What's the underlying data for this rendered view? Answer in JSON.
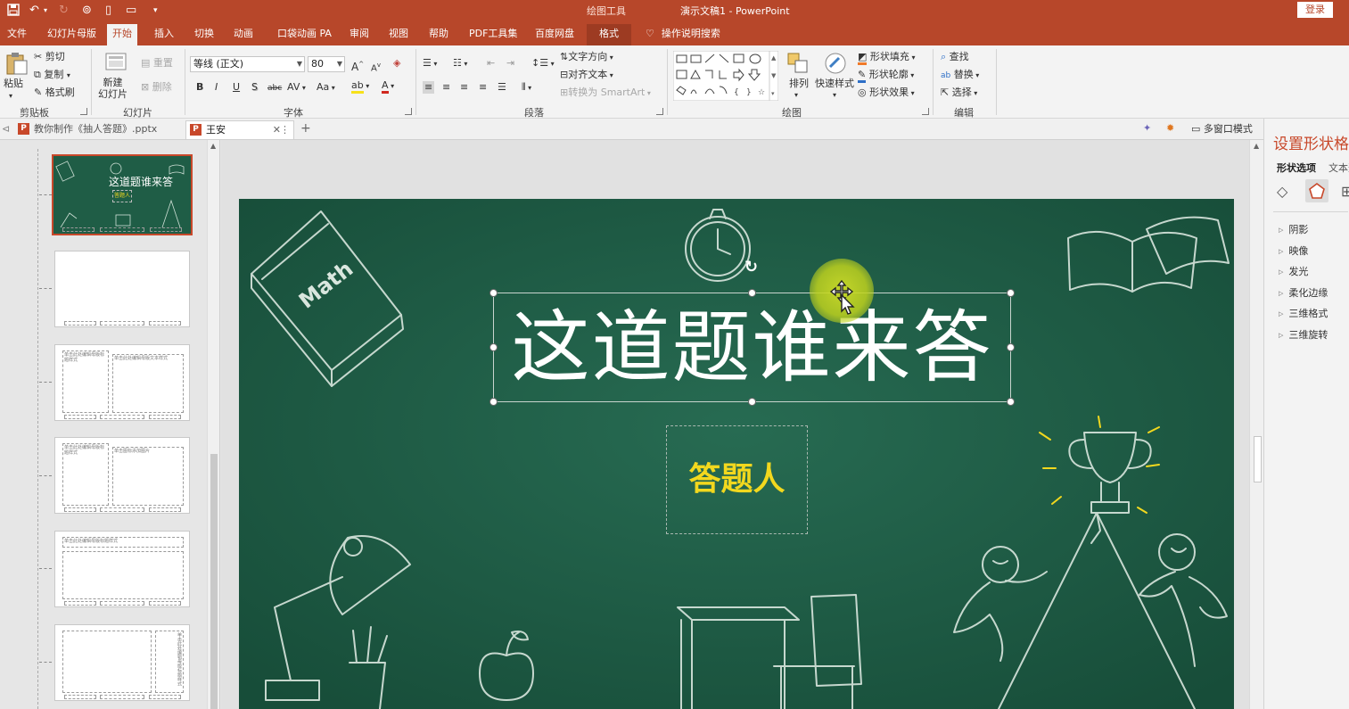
{
  "titlebar": {
    "context_tools": "绘图工具",
    "document_title": "演示文稿1 - PowerPoint",
    "login": "登录"
  },
  "tabs": [
    {
      "label": "文件"
    },
    {
      "label": "幻灯片母版"
    },
    {
      "label": "开始",
      "active": true
    },
    {
      "label": "插入"
    },
    {
      "label": "切换"
    },
    {
      "label": "动画"
    },
    {
      "label": "口袋动画 PA"
    },
    {
      "label": "审阅"
    },
    {
      "label": "视图"
    },
    {
      "label": "帮助"
    },
    {
      "label": "PDF工具集"
    },
    {
      "label": "百度网盘"
    },
    {
      "label": "格式"
    }
  ],
  "tell_me": "操作说明搜索",
  "ribbon": {
    "clipboard": {
      "paste": "粘贴",
      "cut": "剪切",
      "copy": "复制",
      "format_painter": "格式刷",
      "label": "剪贴板"
    },
    "slides": {
      "new_slide": "新建\n幻灯片",
      "reset": "重置",
      "delete": "删除",
      "label": "幻灯片"
    },
    "font": {
      "name": "等线 (正文)",
      "size": "80",
      "label": "字体",
      "bold": "B",
      "italic": "I",
      "underline": "U",
      "shadow": "S",
      "strike": "abc",
      "spacing": "AV",
      "case": "Aa",
      "grow": "A",
      "shrink": "A"
    },
    "paragraph": {
      "text_direction": "文字方向",
      "align_text": "对齐文本",
      "smartart": "转换为 SmartArt",
      "label": "段落"
    },
    "drawing": {
      "arrange": "排列",
      "quick_styles": "快速样式",
      "shape_fill": "形状填充",
      "shape_outline": "形状轮廓",
      "shape_effects": "形状效果",
      "label": "绘图"
    },
    "editing": {
      "find": "查找",
      "replace": "替换",
      "select": "选择",
      "label": "编辑"
    }
  },
  "doc_tabs": [
    {
      "label": "教你制作《抽人答题》.pptx"
    },
    {
      "label": "王安",
      "active": true
    }
  ],
  "multiwindow": "多窗口模式",
  "slide": {
    "title": "这道题谁来答",
    "subtitle": "答题人",
    "book_label": "Math"
  },
  "thumbnails": [
    {
      "title": "这道题谁来答",
      "subtitle": "答题人"
    },
    {
      "title": ""
    },
    {
      "title": "单击此处编辑母版标题样式",
      "body": "单击此处编辑母版文本样式"
    },
    {
      "title": "单击此处编辑母版标题样式",
      "body": "单击图标添加图片"
    },
    {
      "title": "单击此处编辑母版标题样式"
    },
    {
      "title": "单击此处编辑母版标题样式"
    }
  ],
  "format_pane": {
    "title": "设置形状格式",
    "option_shape": "形状选项",
    "option_text": "文本选项",
    "properties": [
      "阴影",
      "映像",
      "发光",
      "柔化边缘",
      "三维格式",
      "三维旋转"
    ]
  },
  "colors": {
    "accent": "#b7472a",
    "slide_bg": "#1f5d46",
    "subtitle": "#f2d81e"
  }
}
